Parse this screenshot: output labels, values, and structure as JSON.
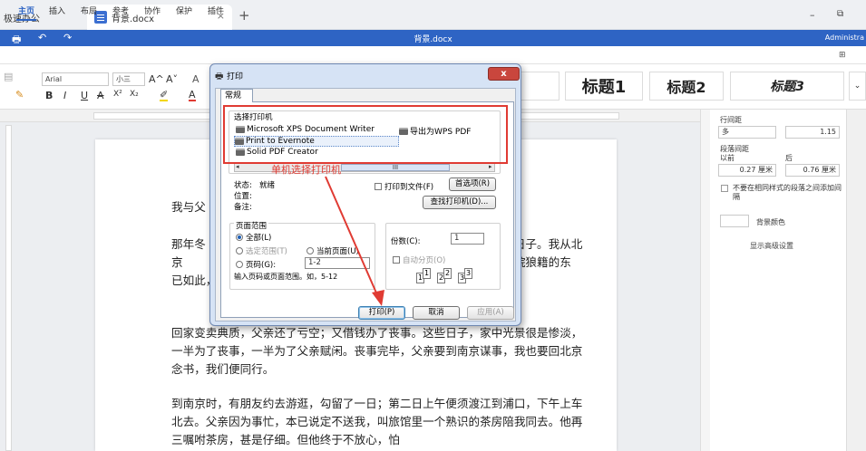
{
  "tabs": {
    "app_label": "极速办公",
    "doc_label": "背景.docx",
    "close": "×",
    "new": "+"
  },
  "window": {
    "min": "–",
    "max": "⧉"
  },
  "titlebar": {
    "title": "背景.docx",
    "user": "Administra"
  },
  "menu": [
    "主页",
    "插入",
    "布局",
    "参考",
    "协作",
    "保护",
    "插件"
  ],
  "ribbon": {
    "font_name": "Arial",
    "font_size": "小三",
    "bold": "B",
    "italic": "I",
    "underline": "U",
    "strike": "A",
    "sup": "X²",
    "sub": "X₂",
    "grow": "A^",
    "shrink": "A˅"
  },
  "styles": [
    "标题1",
    "标题2",
    "标题3"
  ],
  "document": {
    "paragraphs": [
      "我与父",
      "那年冬　　　　　　　　　　　　　　　　　　　　　　　　　　的日子。我从北京　　　　　　　　　　　　　　　　　　　　　　　　　　看见满院狼籍的东　　　　　　　　　　　　　　　　　　　　　　　　　　已如此，不必难",
      "回家变卖典质，父亲还了亏空；又借钱办了丧事。这些日子，家中光景很是惨淡，一半为了丧事，一半为了父亲赋闲。丧事完毕，父亲要到南京谋事，我也要回北京念书，我们便同行。",
      "到南京时，有朋友约去游逛，勾留了一日；第二日上午便须渡江到浦口，下午上车北去。父亲因为事忙，本已说定不送我，叫旅馆里一个熟识的茶房陪我同去。他再三嘱咐茶房，甚是仔细。但他终于不放心，怕"
    ]
  },
  "right_panel": {
    "line_spacing_label": "行间距",
    "line_spacing_mode": "多",
    "line_spacing_value": "1.15",
    "para_spacing_label": "段落间距",
    "before_label": "以前",
    "after_label": "后",
    "before_value": "0.27 厘米",
    "after_value": "0.76 厘米",
    "no_space_label": "不要在相同样式的段落之间添加间隔",
    "bg_color_label": "背景颜色",
    "advanced_label": "显示高级设置"
  },
  "dialog": {
    "title": "打印",
    "close": "x",
    "tab": "常规",
    "select_printer_label": "选择打印机",
    "printers": [
      "Microsoft XPS Document Writer",
      "导出为WPS PDF",
      "Print to Evernote",
      "Solid PDF Creator"
    ],
    "status_label": "状态:",
    "status_value": "就绪",
    "location_label": "位置:",
    "comment_label": "备注:",
    "print_to_file": "打印到文件(F)",
    "preferences": "首选项(R)",
    "find_printer": "查找打印机(D)...",
    "range_label": "页面范围",
    "range_all": "全部(L)",
    "range_selection": "选定范围(T)",
    "range_current": "当前页面(U)",
    "range_pages": "页码(G):",
    "pages_value": "1-2",
    "range_hint": "输入页码或页面范围。如，5-12",
    "copies_label": "份数(C):",
    "copies_value": "1",
    "collate_label": "自动分页(O)",
    "print_btn": "打印(P)",
    "cancel_btn": "取消",
    "apply_btn": "应用(A)",
    "scroll_thumb": "III"
  },
  "annotation": {
    "text": "单机选择打印机",
    "color": "#e03b33"
  }
}
